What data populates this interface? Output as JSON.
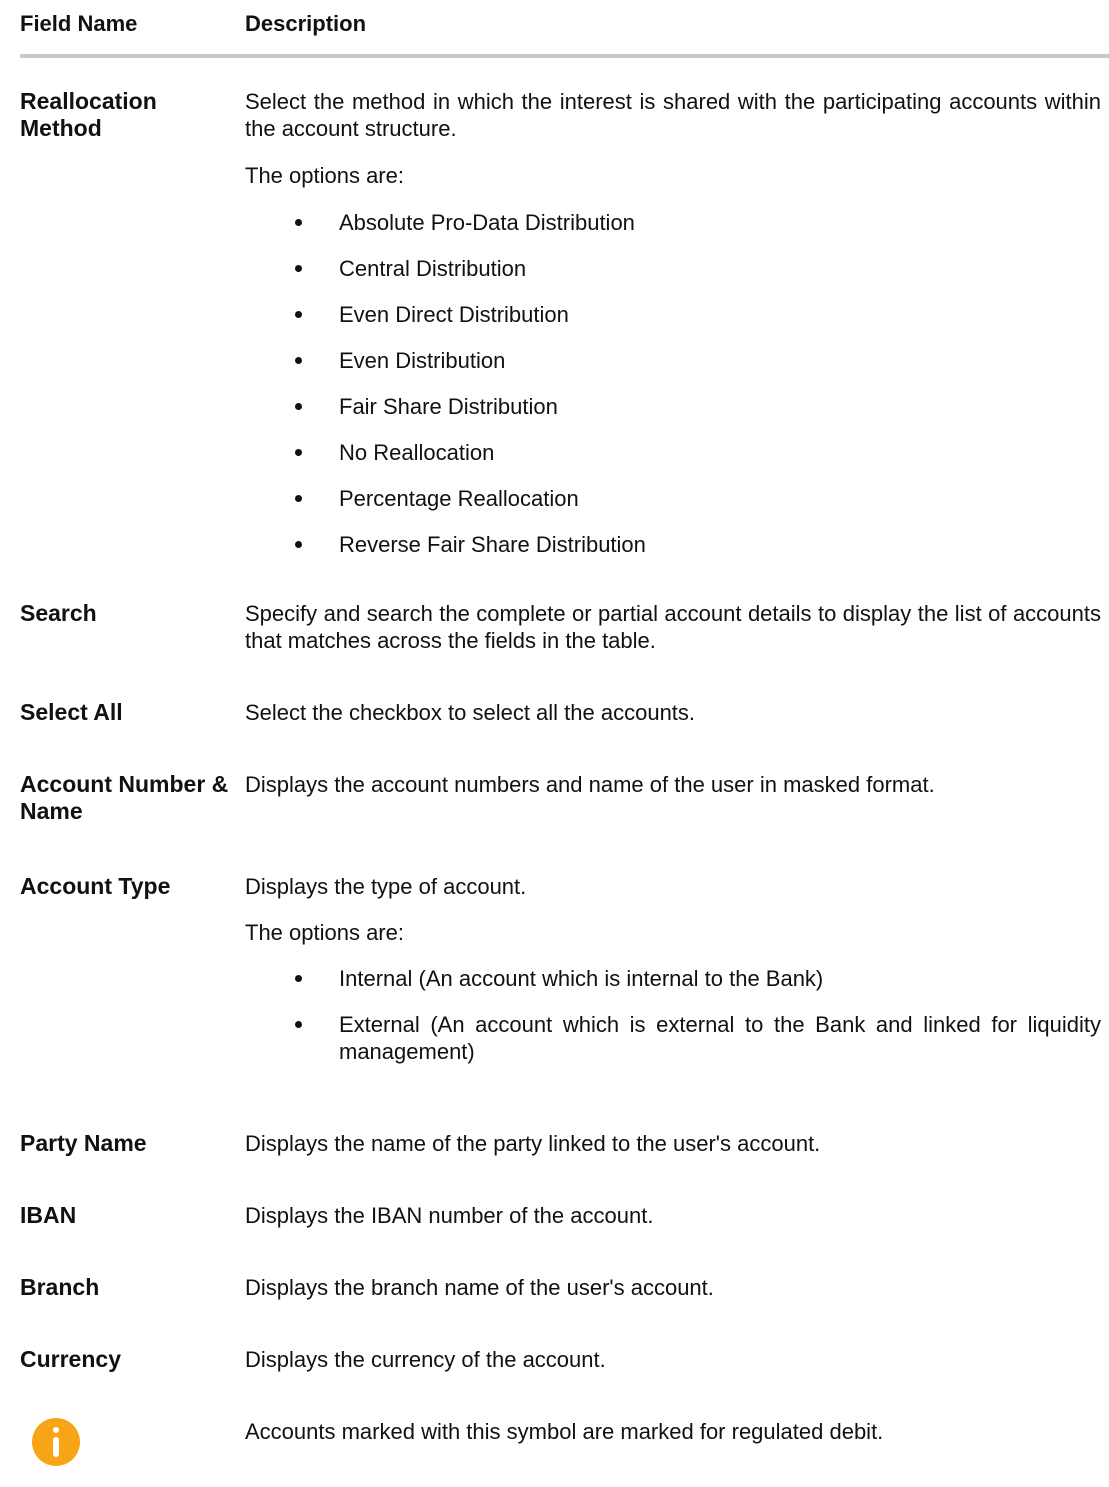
{
  "header": {
    "field_name": "Field Name",
    "description": "Description"
  },
  "rows": [
    {
      "label": "Reallocation Method",
      "desc": "Select the method in which the interest is shared with the participating accounts within the account structure.",
      "options_title": "The options are:",
      "options": [
        "Absolute Pro-Data Distribution",
        "Central Distribution",
        "Even Direct Distribution",
        "Even Distribution",
        "Fair Share Distribution",
        "No Reallocation",
        "Percentage Reallocation",
        "Reverse Fair Share Distribution"
      ]
    },
    {
      "label": "Search",
      "desc": "Specify and search the complete or partial account details to display the list of accounts that matches across the fields in the table."
    },
    {
      "label": "Select All",
      "desc": "Select the checkbox to select all the accounts."
    },
    {
      "label": "Account Number & Name",
      "desc": "Displays the account numbers and name of the user in masked format."
    },
    {
      "label": "Account Type",
      "desc": "Displays the type of account.",
      "options_title": "The options are:",
      "options": [
        "Internal (An account which is internal to the Bank)",
        "External (An account which is external to the Bank and linked for liquidity management)"
      ]
    },
    {
      "label": "Party Name",
      "desc": "Displays the name of the party linked to the user's account."
    },
    {
      "label": "IBAN",
      "desc": "Displays the IBAN number of the account."
    },
    {
      "label": "Branch",
      "desc": "Displays the branch name of the user's account."
    },
    {
      "label": "Currency",
      "desc": "Displays the currency of the account."
    },
    {
      "icon": "info-icon",
      "icon_color": "#f7a416",
      "desc": "Accounts marked with this symbol are marked for regulated debit."
    }
  ]
}
